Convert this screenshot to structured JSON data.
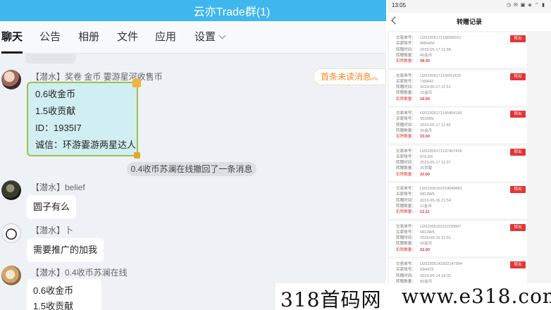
{
  "chat": {
    "title": "云亦Trade群(1)",
    "tabs": [
      {
        "label": "聊天",
        "active": true
      },
      {
        "label": "公告"
      },
      {
        "label": "相册"
      },
      {
        "label": "文件"
      },
      {
        "label": "应用"
      },
      {
        "label": "设置"
      }
    ],
    "unread_label": "首条未读消息",
    "messages": [
      {
        "sender": "【潜水】奖卷 金币 霎游星河收售币",
        "card_lines": [
          "0.6收金币",
          "1.5收贡献",
          "ID：1935I7",
          "诚信：环游霎游两星达人"
        ]
      },
      {
        "system": "0.4收币苏澜在线撤回了一条消息"
      },
      {
        "sender": "【潜水】belief",
        "text": "圆子有么"
      },
      {
        "sender": "【潜水】卜",
        "text": "需要推广的加我"
      },
      {
        "sender": "【潜水】0.4收币苏澜在线",
        "lines": [
          "0.6收金币",
          "1.5收贡献"
        ]
      }
    ]
  },
  "phone": {
    "time": "13:05",
    "status_icons": "◷ ✉ ▣ ◈ ⌔ ▮",
    "title": "转赠记录",
    "labels": {
      "order": "交易单号：",
      "buyer": "买家账号：",
      "time": "转赠时间：",
      "amount": "转赠数量：",
      "deduct": "扣除数量："
    },
    "button": "转出",
    "records": [
      {
        "order": "U2023051711583I8315",
        "buyer": "W8645F",
        "time": "2023-05-17 11:58",
        "amount": "45金币",
        "deduct": "49.50"
      },
      {
        "order": "U20230517115I001420",
        "buyer": "739A42",
        "time": "2023-05-17 11:51",
        "amount": "15金币",
        "deduct": "16.50"
      },
      {
        "order": "U202305171145454190",
        "buyer": "95168N",
        "time": "2023-05-17 11:45",
        "amount": "30金币",
        "deduct": "33.00"
      },
      {
        "order": "U202305171137457418",
        "buyer": "876J26",
        "time": "2023-05-17 11:37",
        "amount": "20贡献",
        "deduct": "22.00"
      },
      {
        "order": "U202305162154048561",
        "buyer": "6813W5",
        "time": "2023-05-16 21:54",
        "amount": "11金币",
        "deduct": "12.11"
      },
      {
        "order": "U20230516215I190657",
        "buyer": "6813W5",
        "time": "2023-05-16 21:51",
        "amount": "20金币",
        "deduct": "22.00"
      },
      {
        "order": "U202305141832147904",
        "buyer": "69H522",
        "time": "2023-05-14 18:32",
        "amount": "80金币",
        "deduct": "88.00"
      }
    ]
  },
  "watermark": {
    "left": "318首码网",
    "right": "www.e318.com"
  }
}
